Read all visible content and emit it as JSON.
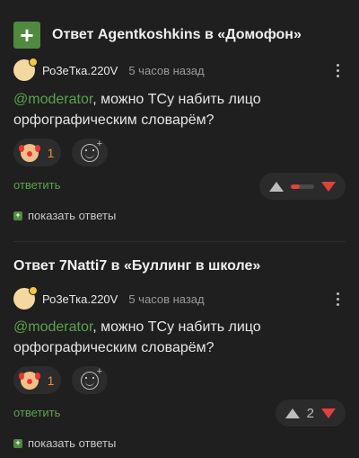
{
  "comments": [
    {
      "header": "Ответ Agentkoshkins в «Домофон»",
      "author": "Ро3еТка.220V",
      "time": "5 часов назад",
      "mention": "@moderator",
      "text": ", можно ТСу набить лицо орфографическим словарём?",
      "reaction_count": "1",
      "reaction_icon": "clown-emoji",
      "reply_label": "ответить",
      "vote_score_fraction": 0.4,
      "show_replies_label": "показать ответы"
    },
    {
      "header": "Ответ 7Natti7 в «Буллинг в школе»",
      "author": "Ро3еТка.220V",
      "time": "5 часов назад",
      "mention": "@moderator",
      "text": ", можно ТСу набить лицо орфографическим словарём?",
      "reaction_count": "1",
      "reaction_icon": "clown-emoji",
      "reply_label": "ответить",
      "vote_count": "2",
      "show_replies_label": "показать ответы"
    }
  ],
  "colors": {
    "accent_green": "#4f8a3e",
    "link_green": "#5aa44a",
    "downvote_red": "#e0413b",
    "background": "#1f1f1f"
  }
}
